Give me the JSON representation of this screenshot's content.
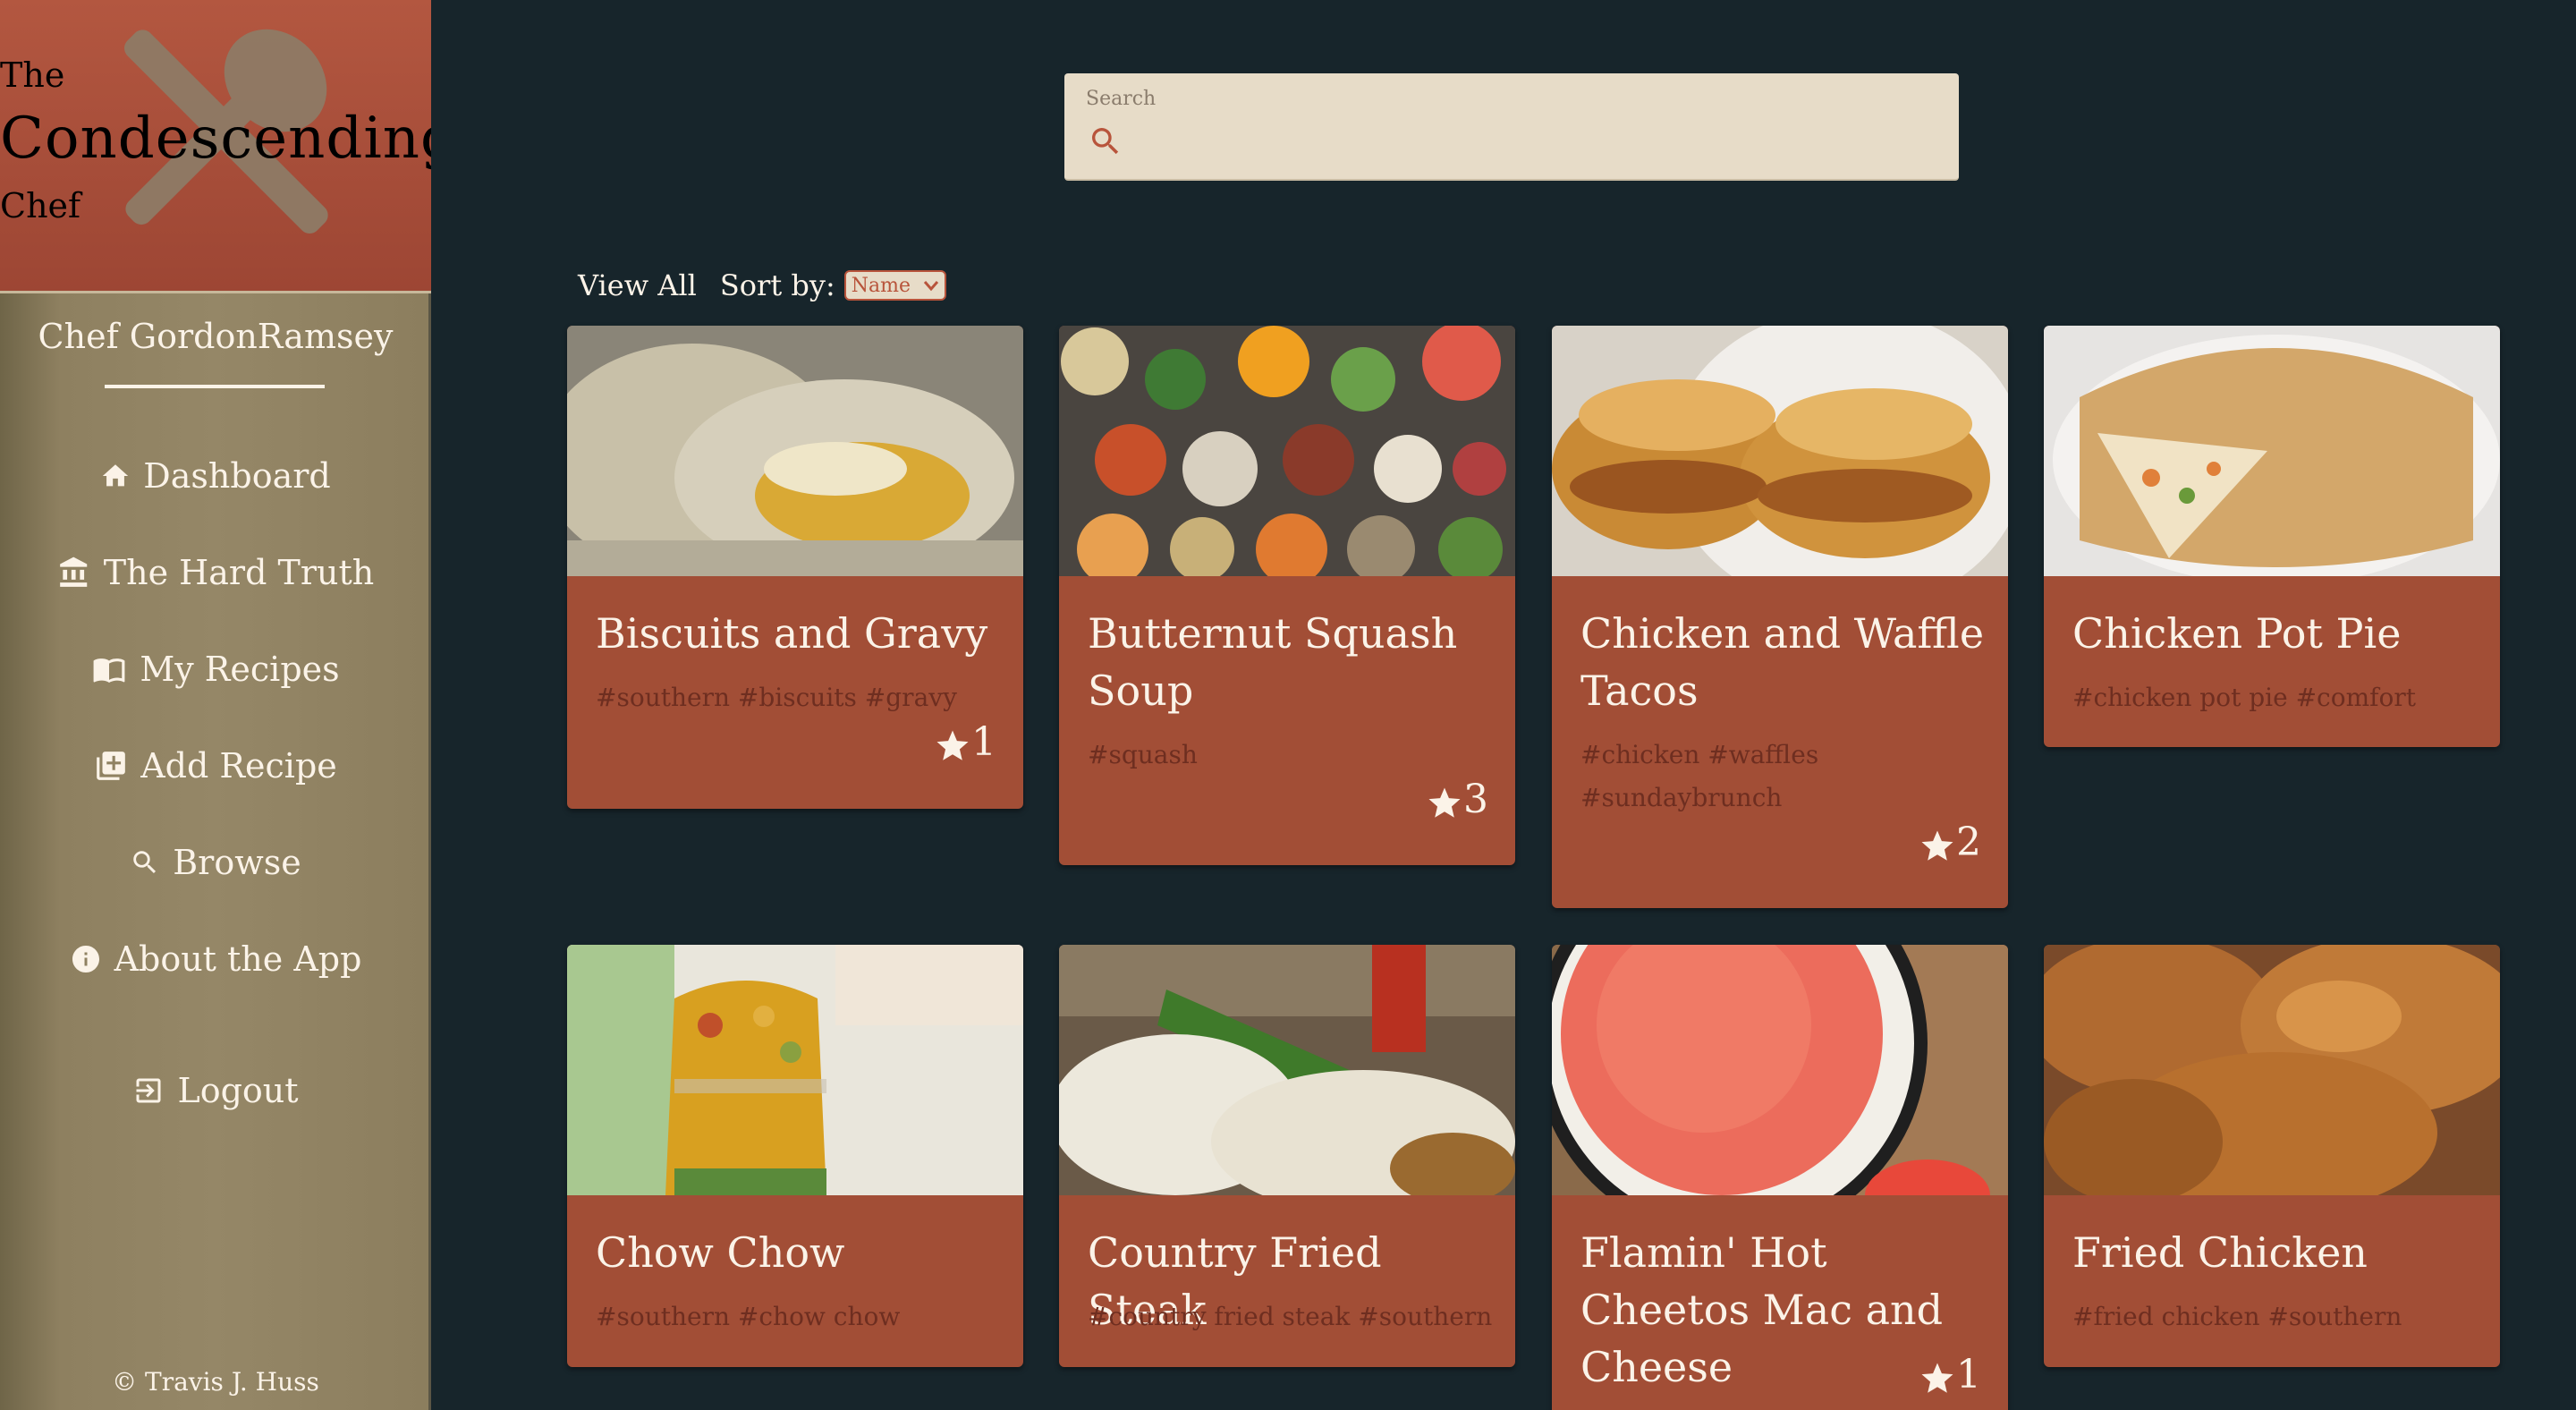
{
  "brand": {
    "line1": "The",
    "line2": "Condescending",
    "line3": "Chef"
  },
  "user": {
    "name": "Chef GordonRamsey"
  },
  "nav": [
    {
      "label": "Dashboard",
      "icon": "home-icon"
    },
    {
      "label": "The Hard Truth",
      "icon": "bank-icon"
    },
    {
      "label": "My Recipes",
      "icon": "book-icon"
    },
    {
      "label": "Add Recipe",
      "icon": "add-box-icon"
    },
    {
      "label": "Browse",
      "icon": "search-icon"
    },
    {
      "label": "About the App",
      "icon": "info-icon"
    },
    {
      "label": "Logout",
      "icon": "logout-icon"
    }
  ],
  "footer": {
    "copyright": "© Travis J. Huss"
  },
  "search": {
    "label": "Search",
    "value": ""
  },
  "controls": {
    "view_all": "View All",
    "sort_label": "Sort by:",
    "sort_value": "Name"
  },
  "recipes": [
    {
      "title": "Biscuits and Gravy",
      "tags": "#southern #biscuits #gravy",
      "stars": "1"
    },
    {
      "title": "Butternut Squash Soup",
      "tags": "#squash",
      "stars": "3"
    },
    {
      "title": "Chicken and Waffle Tacos",
      "tags": "#chicken #waffles #sundaybrunch",
      "stars": "2"
    },
    {
      "title": "Chicken Pot Pie",
      "tags": "#chicken pot pie #comfort",
      "stars": ""
    },
    {
      "title": "Chow Chow",
      "tags": "#southern #chow chow",
      "stars": ""
    },
    {
      "title": "Country Fried Steak",
      "tags": "#country fried steak #southern",
      "stars": ""
    },
    {
      "title": "Flamin' Hot Cheetos Mac and Cheese",
      "tags": "",
      "stars": "1"
    },
    {
      "title": "Fried Chicken",
      "tags": "#fried chicken #southern",
      "stars": ""
    }
  ],
  "colors": {
    "sidebar": "#958767",
    "brand": "#a94f3a",
    "card": "#a24e36",
    "background": "#17252b",
    "search": "#e7dcc8"
  }
}
